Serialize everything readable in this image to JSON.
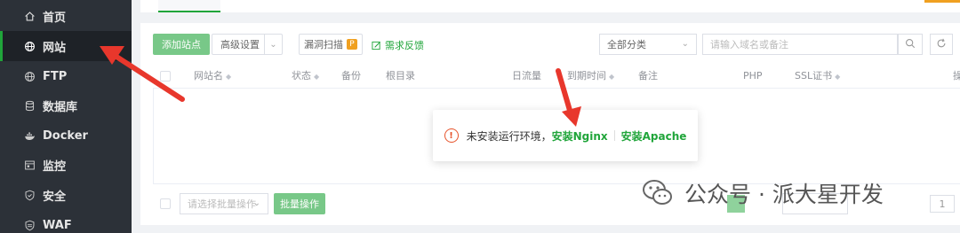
{
  "sidebar": {
    "items": [
      {
        "label": "首页",
        "icon": "home-icon"
      },
      {
        "label": "网站",
        "icon": "globe-icon",
        "active": true
      },
      {
        "label": "FTP",
        "icon": "ftp-globe-icon"
      },
      {
        "label": "数据库",
        "icon": "database-icon"
      },
      {
        "label": "Docker",
        "icon": "docker-icon"
      },
      {
        "label": "监控",
        "icon": "monitor-icon"
      },
      {
        "label": "安全",
        "icon": "shield-icon"
      },
      {
        "label": "WAF",
        "icon": "waf-shield-icon"
      }
    ]
  },
  "toolbar": {
    "add_site": "添加站点",
    "advanced": "高级设置",
    "vuln_scan": "漏洞扫描",
    "vuln_badge": "P",
    "feedback": "需求反馈",
    "category_select": "全部分类",
    "search_placeholder": "请输入域名或备注"
  },
  "table": {
    "columns": [
      "网站名",
      "状态",
      "备份",
      "根目录",
      "日流量",
      "到期时间",
      "备注",
      "PHP",
      "SSL证书",
      "操"
    ]
  },
  "popup": {
    "message": "未安装运行环境，",
    "install_nginx": "安装Nginx",
    "install_apache": "安装Apache",
    "warn_symbol": "!"
  },
  "footer": {
    "batch_select_placeholder": "请选择批量操作",
    "batch_action": "批量操作",
    "page_number": "1"
  },
  "watermark": {
    "text": "公众号 · 派大星开发"
  },
  "colors": {
    "sidebar_bg": "#2c3138",
    "accent_green": "#20a53a",
    "warning_orange": "#e6532b",
    "arrow_red": "#e8372c"
  }
}
